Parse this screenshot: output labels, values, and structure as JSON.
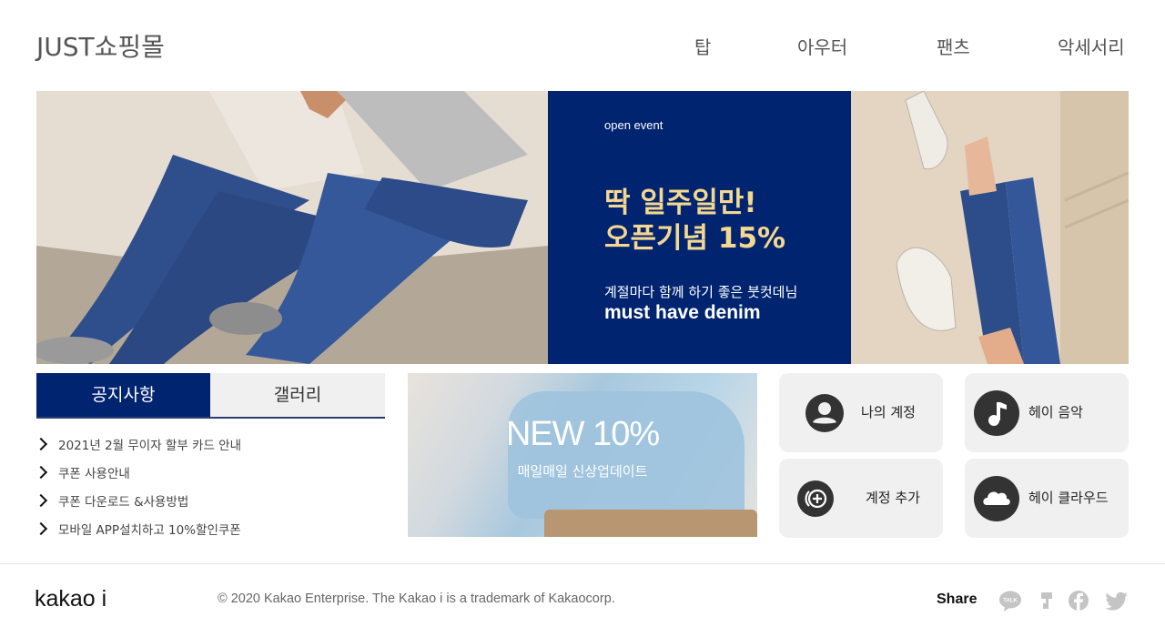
{
  "header": {
    "logo": "JUST쇼핑몰",
    "nav": [
      "탑",
      "아우터",
      "팬츠",
      "악세서리"
    ]
  },
  "banner": {
    "event_label": "open event",
    "headline_1": "딱 일주일만!",
    "headline_2": "오픈기념 15%",
    "subcopy": "계절마다 함께 하기 좋은 붓컷데님",
    "tagline": "must have denim"
  },
  "tabs": {
    "notice": "공지사항",
    "gallery": "갤러리"
  },
  "notices": [
    "2021년 2월 무이자 할부 카드 안내",
    "쿠폰 사용안내",
    "쿠폰 다운로드 &사용방법",
    "모바일 APP설치하고 10%할인쿠폰"
  ],
  "promo": {
    "title": "NEW 10%",
    "subtitle": "매일매일 신상업데이트"
  },
  "cards": {
    "account": "나의 계정",
    "music": "헤이 음악",
    "add_account": "계정 추가",
    "cloud": "헤이 클라우드"
  },
  "footer": {
    "logo": "kakao i",
    "copyright": "© 2020 Kakao Enterprise. The Kakao i is a trademark of Kakaocorp.",
    "share_label": "Share",
    "talk_icon_text": "TALK"
  },
  "colors": {
    "navy": "#012470",
    "gold": "#f5d890",
    "card_bg": "#f0f0f0",
    "icon_dark": "#333333",
    "share_icons": "#c4c4c4"
  }
}
